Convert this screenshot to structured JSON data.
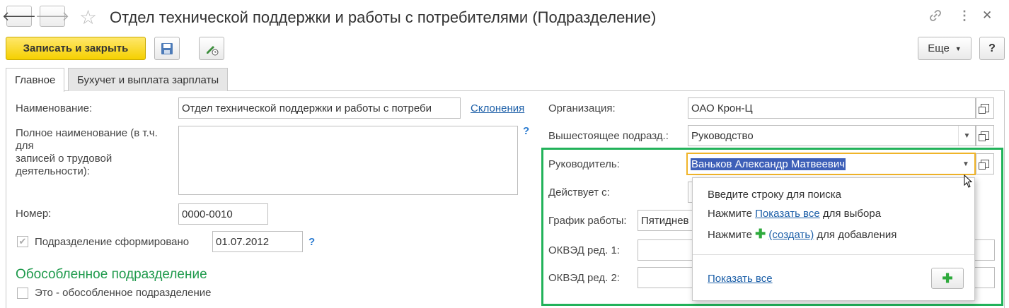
{
  "header": {
    "title": "Отдел технической поддержки и работы с потребителями (Подразделение)",
    "back_icon": "arrow-left",
    "forward_icon": "arrow-right",
    "star_icon": "star",
    "link_icon": "link",
    "menu_icon": "more-vertical",
    "close_icon": "close"
  },
  "toolbar": {
    "save_close_label": "Записать и закрыть",
    "more_label": "Еще",
    "help_label": "?"
  },
  "tabs": [
    {
      "label": "Главное",
      "active": true
    },
    {
      "label": "Бухучет и выплата зарплаты",
      "active": false
    }
  ],
  "left": {
    "name_label": "Наименование:",
    "name_value": "Отдел технической поддержки и работы с потреби",
    "declensions_link": "Склонения",
    "full_name_label_lines": [
      "Полное наименование (в т.ч.",
      "для",
      "записей о трудовой",
      "деятельности):"
    ],
    "full_name_value": "",
    "help_mark": "?",
    "number_label": "Номер:",
    "number_value": "0000-0010",
    "formed_label": "Подразделение сформировано",
    "formed_checked": true,
    "formed_date": "01.07.2012",
    "separate_section_title": "Обособленное подразделение",
    "separate_checkbox_label": "Это - обособленное подразделение",
    "separate_checked": false
  },
  "right": {
    "org_label": "Организация:",
    "org_value": "ОАО Крон-Ц",
    "parent_label": "Вышестоящее подразд.:",
    "parent_value": "Руководство",
    "head_label": "Руководитель:",
    "head_value": "Ваньков Александр Матвеевич",
    "valid_from_label": "Действует с:",
    "schedule_label": "График работы:",
    "schedule_value": "Пятиднев",
    "okved1_label": "ОКВЭД ред. 1:",
    "okved2_label": "ОКВЭД ред. 2:"
  },
  "popup": {
    "line1": "Введите строку для поиска",
    "line2_prefix": "Нажмите",
    "line2_link": "Показать все",
    "line2_suffix": "для выбора",
    "line3_prefix": "Нажмите",
    "line3_link": "(создать)",
    "line3_suffix": "для добавления",
    "show_all_link": "Показать все",
    "add_icon": "plus"
  },
  "colors": {
    "primary_button": "#f5d000",
    "highlight_border": "#22b25a",
    "section_title": "#1f9a4c",
    "link": "#1c5fa8",
    "focus_border": "#f0b429",
    "selection": "#3d5fb8"
  }
}
